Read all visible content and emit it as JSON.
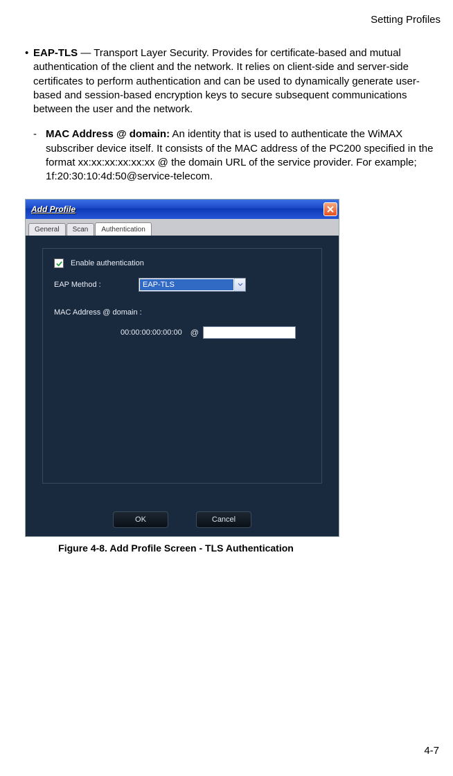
{
  "header": {
    "section": "Setting Profiles"
  },
  "body": {
    "eap_bold": "EAP-TLS",
    "eap_text": " — Transport Layer Security. Provides for certificate-based and mutual authentication of the client and the network. It relies on client-side and server-side certificates to perform authentication and can be used to dynamically generate user-based and session-based encryption keys to secure subsequent communications between the user and the network.",
    "mac_bold": "MAC Address @ domain:",
    "mac_text": " An identity that is used to authenticate the WiMAX subscriber device itself. It consists of the MAC address of the PC200 specified in the format xx:xx:xx:xx:xx:xx @ the domain URL of the service provider. For example; 1f:20:30:10:4d:50@service-telecom."
  },
  "dialog": {
    "title": "Add Profile",
    "tabs": [
      "General",
      "Scan",
      "Authentication"
    ],
    "active_tab": 2,
    "enable_auth_label": "Enable authentication",
    "enable_auth_checked": true,
    "eap_method_label": "EAP Method :",
    "eap_method_value": "EAP-TLS",
    "mac_domain_label": "MAC Address @ domain :",
    "mac_value": "00:00:00:00:00:00",
    "at_symbol": "@",
    "domain_value": "",
    "ok_label": "OK",
    "cancel_label": "Cancel"
  },
  "figure_caption": "Figure 4-8.  Add Profile Screen - TLS Authentication",
  "page_number": "4-7"
}
